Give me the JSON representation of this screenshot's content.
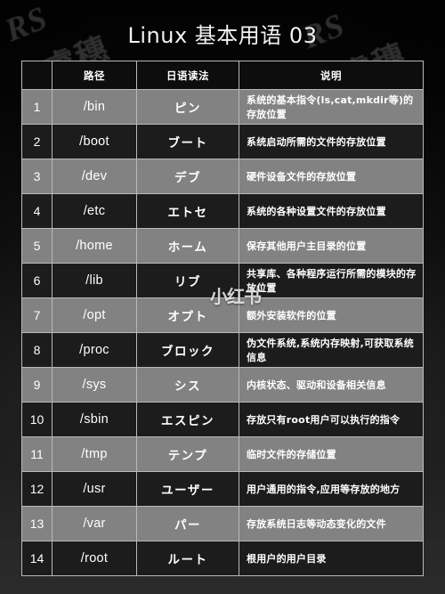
{
  "title": "Linux 基本用语 03",
  "watermarks": {
    "brand_latin": "RS",
    "brand_cjk": "睿穗",
    "platform": "小红书"
  },
  "table": {
    "headers": {
      "index": "",
      "path": "路径",
      "reading": "日语读法",
      "description": "说明"
    },
    "rows": [
      {
        "index": "1",
        "path": "/bin",
        "reading": "ピン",
        "description": "系统的基本指令(ls,cat,mkdir等)的存放位置"
      },
      {
        "index": "2",
        "path": "/boot",
        "reading": "ブート",
        "description": "系统启动所需的文件的存放位置"
      },
      {
        "index": "3",
        "path": "/dev",
        "reading": "デブ",
        "description": "硬件设备文件的存放位置"
      },
      {
        "index": "4",
        "path": "/etc",
        "reading": "エトセ",
        "description": "系统的各种设置文件的存放位置"
      },
      {
        "index": "5",
        "path": "/home",
        "reading": "ホーム",
        "description": "保存其他用户主目录的位置"
      },
      {
        "index": "6",
        "path": "/lib",
        "reading": "リブ",
        "description": "共享库、各种程序运行所需的模块的存放位置"
      },
      {
        "index": "7",
        "path": "/opt",
        "reading": "オプト",
        "description": "额外安装软件的位置"
      },
      {
        "index": "8",
        "path": "/proc",
        "reading": "ブロック",
        "description": "伪文件系统,系统内存映射,可获取系统信息"
      },
      {
        "index": "9",
        "path": "/sys",
        "reading": "シス",
        "description": "内核状态、驱动和设备相关信息"
      },
      {
        "index": "10",
        "path": "/sbin",
        "reading": "エスピン",
        "description": "存放只有root用户可以执行的指令"
      },
      {
        "index": "11",
        "path": "/tmp",
        "reading": "テンプ",
        "description": "临时文件的存储位置"
      },
      {
        "index": "12",
        "path": "/usr",
        "reading": "ユーザー",
        "description": "用户通用的指令,应用等存放的地方"
      },
      {
        "index": "13",
        "path": "/var",
        "reading": "パー",
        "description": "存放系统日志等动态变化的文件"
      },
      {
        "index": "14",
        "path": "/root",
        "reading": "ルート",
        "description": "根用户的用户目录"
      }
    ]
  },
  "colors": {
    "row_light": "#828282",
    "row_dark": "#1c1c1c",
    "header_bg": "#0d0d0d",
    "border": "#b9b9b9",
    "text": "#ffffff"
  }
}
